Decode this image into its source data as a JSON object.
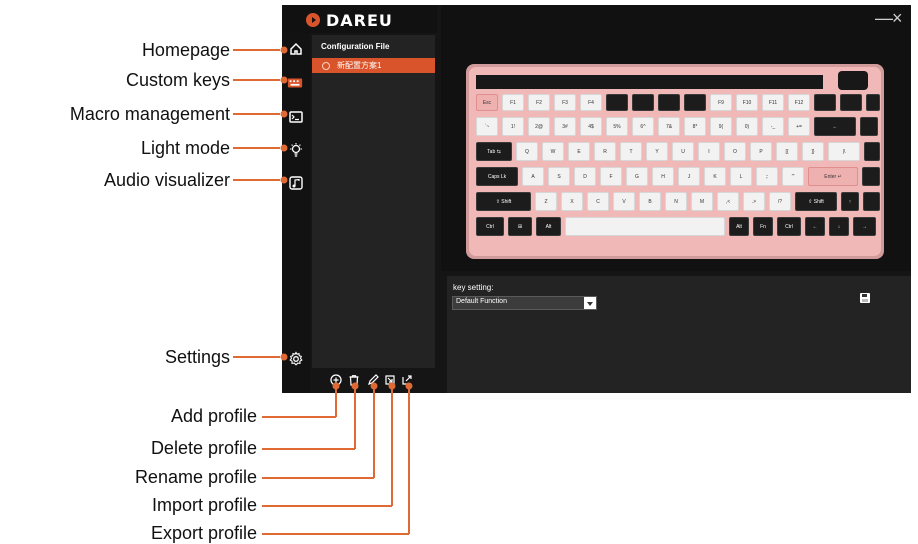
{
  "app": {
    "brand": "DAREU",
    "window": {
      "minimize": "—",
      "close": "×"
    },
    "profiles": {
      "heading": "Configuration File",
      "items": [
        {
          "name": "新配置方案1"
        }
      ]
    },
    "key_setting": {
      "label": "key setting:",
      "value": "Default Function"
    }
  },
  "annotations": {
    "homepage": "Homepage",
    "custom_keys": "Custom keys",
    "macro_management": "Macro management",
    "light_mode": "Light mode",
    "audio_visualizer": "Audio visualizer",
    "settings": "Settings",
    "add_profile": "Add profile",
    "delete_profile": "Delete profile",
    "rename_profile": "Rename profile",
    "import_profile": "Import profile",
    "export_profile": "Export profile"
  },
  "keyboard": {
    "rows": [
      [
        "Esc",
        "F1",
        "F2",
        "F3",
        "F4",
        "",
        "",
        "",
        "",
        "F9",
        "F10",
        "F11",
        "F12",
        "",
        "",
        ""
      ],
      [
        "`~",
        "1!",
        "2@",
        "3#",
        "4$",
        "5%",
        "6^",
        "7&",
        "8*",
        "9(",
        "0)",
        "-_",
        "+=",
        "←",
        "",
        ""
      ],
      [
        "Tab ⇆",
        "Q",
        "W",
        "E",
        "R",
        "T",
        "Y",
        "U",
        "I",
        "O",
        "P",
        "[{",
        "]}",
        "|\\",
        ""
      ],
      [
        "Caps Lk",
        "A",
        "S",
        "D",
        "F",
        "G",
        "H",
        "J",
        "K",
        "L",
        ";:",
        "'\"",
        "Enter ↵",
        ""
      ],
      [
        "⇧ Shift",
        "Z",
        "X",
        "C",
        "V",
        "B",
        "N",
        "M",
        ",<",
        ".>",
        "/?",
        "⇧ Shift",
        "↑",
        ""
      ],
      [
        "Ctrl",
        "⊞",
        "Alt",
        "",
        "Alt",
        "Fn",
        "Ctrl",
        "←",
        "↓",
        "→"
      ]
    ]
  }
}
